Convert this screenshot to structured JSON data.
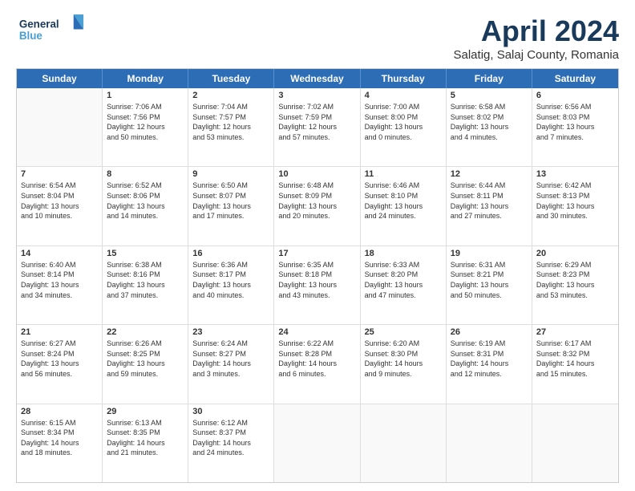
{
  "header": {
    "logo_general": "General",
    "logo_blue": "Blue",
    "main_title": "April 2024",
    "subtitle": "Salatig, Salaj County, Romania"
  },
  "days_of_week": [
    "Sunday",
    "Monday",
    "Tuesday",
    "Wednesday",
    "Thursday",
    "Friday",
    "Saturday"
  ],
  "weeks": [
    [
      {
        "day": "",
        "info": ""
      },
      {
        "day": "1",
        "info": "Sunrise: 7:06 AM\nSunset: 7:56 PM\nDaylight: 12 hours\nand 50 minutes."
      },
      {
        "day": "2",
        "info": "Sunrise: 7:04 AM\nSunset: 7:57 PM\nDaylight: 12 hours\nand 53 minutes."
      },
      {
        "day": "3",
        "info": "Sunrise: 7:02 AM\nSunset: 7:59 PM\nDaylight: 12 hours\nand 57 minutes."
      },
      {
        "day": "4",
        "info": "Sunrise: 7:00 AM\nSunset: 8:00 PM\nDaylight: 13 hours\nand 0 minutes."
      },
      {
        "day": "5",
        "info": "Sunrise: 6:58 AM\nSunset: 8:02 PM\nDaylight: 13 hours\nand 4 minutes."
      },
      {
        "day": "6",
        "info": "Sunrise: 6:56 AM\nSunset: 8:03 PM\nDaylight: 13 hours\nand 7 minutes."
      }
    ],
    [
      {
        "day": "7",
        "info": "Sunrise: 6:54 AM\nSunset: 8:04 PM\nDaylight: 13 hours\nand 10 minutes."
      },
      {
        "day": "8",
        "info": "Sunrise: 6:52 AM\nSunset: 8:06 PM\nDaylight: 13 hours\nand 14 minutes."
      },
      {
        "day": "9",
        "info": "Sunrise: 6:50 AM\nSunset: 8:07 PM\nDaylight: 13 hours\nand 17 minutes."
      },
      {
        "day": "10",
        "info": "Sunrise: 6:48 AM\nSunset: 8:09 PM\nDaylight: 13 hours\nand 20 minutes."
      },
      {
        "day": "11",
        "info": "Sunrise: 6:46 AM\nSunset: 8:10 PM\nDaylight: 13 hours\nand 24 minutes."
      },
      {
        "day": "12",
        "info": "Sunrise: 6:44 AM\nSunset: 8:11 PM\nDaylight: 13 hours\nand 27 minutes."
      },
      {
        "day": "13",
        "info": "Sunrise: 6:42 AM\nSunset: 8:13 PM\nDaylight: 13 hours\nand 30 minutes."
      }
    ],
    [
      {
        "day": "14",
        "info": "Sunrise: 6:40 AM\nSunset: 8:14 PM\nDaylight: 13 hours\nand 34 minutes."
      },
      {
        "day": "15",
        "info": "Sunrise: 6:38 AM\nSunset: 8:16 PM\nDaylight: 13 hours\nand 37 minutes."
      },
      {
        "day": "16",
        "info": "Sunrise: 6:36 AM\nSunset: 8:17 PM\nDaylight: 13 hours\nand 40 minutes."
      },
      {
        "day": "17",
        "info": "Sunrise: 6:35 AM\nSunset: 8:18 PM\nDaylight: 13 hours\nand 43 minutes."
      },
      {
        "day": "18",
        "info": "Sunrise: 6:33 AM\nSunset: 8:20 PM\nDaylight: 13 hours\nand 47 minutes."
      },
      {
        "day": "19",
        "info": "Sunrise: 6:31 AM\nSunset: 8:21 PM\nDaylight: 13 hours\nand 50 minutes."
      },
      {
        "day": "20",
        "info": "Sunrise: 6:29 AM\nSunset: 8:23 PM\nDaylight: 13 hours\nand 53 minutes."
      }
    ],
    [
      {
        "day": "21",
        "info": "Sunrise: 6:27 AM\nSunset: 8:24 PM\nDaylight: 13 hours\nand 56 minutes."
      },
      {
        "day": "22",
        "info": "Sunrise: 6:26 AM\nSunset: 8:25 PM\nDaylight: 13 hours\nand 59 minutes."
      },
      {
        "day": "23",
        "info": "Sunrise: 6:24 AM\nSunset: 8:27 PM\nDaylight: 14 hours\nand 3 minutes."
      },
      {
        "day": "24",
        "info": "Sunrise: 6:22 AM\nSunset: 8:28 PM\nDaylight: 14 hours\nand 6 minutes."
      },
      {
        "day": "25",
        "info": "Sunrise: 6:20 AM\nSunset: 8:30 PM\nDaylight: 14 hours\nand 9 minutes."
      },
      {
        "day": "26",
        "info": "Sunrise: 6:19 AM\nSunset: 8:31 PM\nDaylight: 14 hours\nand 12 minutes."
      },
      {
        "day": "27",
        "info": "Sunrise: 6:17 AM\nSunset: 8:32 PM\nDaylight: 14 hours\nand 15 minutes."
      }
    ],
    [
      {
        "day": "28",
        "info": "Sunrise: 6:15 AM\nSunset: 8:34 PM\nDaylight: 14 hours\nand 18 minutes."
      },
      {
        "day": "29",
        "info": "Sunrise: 6:13 AM\nSunset: 8:35 PM\nDaylight: 14 hours\nand 21 minutes."
      },
      {
        "day": "30",
        "info": "Sunrise: 6:12 AM\nSunset: 8:37 PM\nDaylight: 14 hours\nand 24 minutes."
      },
      {
        "day": "",
        "info": ""
      },
      {
        "day": "",
        "info": ""
      },
      {
        "day": "",
        "info": ""
      },
      {
        "day": "",
        "info": ""
      }
    ]
  ]
}
